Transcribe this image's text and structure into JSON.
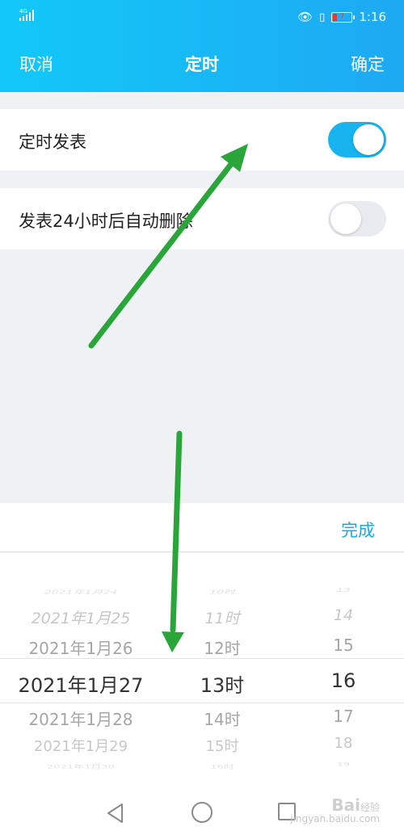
{
  "status_bar": {
    "network": "4G",
    "battery_level": "7",
    "time": "1:16"
  },
  "header": {
    "cancel_label": "取消",
    "title": "定时",
    "confirm_label": "确定"
  },
  "settings": [
    {
      "label": "定时发表",
      "toggle_on": true
    },
    {
      "label": "发表24小时后自动删除",
      "toggle_on": false
    }
  ],
  "picker": {
    "done_label": "完成",
    "dates": [
      "2021年1月24",
      "2021年1月25",
      "2021年1月26",
      "2021年1月27",
      "2021年1月28",
      "2021年1月29",
      "2021年1月30"
    ],
    "hours": [
      "10时",
      "11时",
      "12时",
      "13时",
      "14时",
      "15时",
      "16时"
    ],
    "minutes": [
      "13",
      "14",
      "15",
      "16",
      "17",
      "18",
      "19"
    ],
    "selected": {
      "date": "2021年1月27",
      "hour": "13时",
      "minute": "16"
    }
  },
  "watermark": {
    "brand": "Bai",
    "sub": "经验",
    "url": "jingyan.baidu.com"
  },
  "colors": {
    "accent": "#18b4f0",
    "arrow": "#2aa53a",
    "done": "#18a9e8"
  }
}
